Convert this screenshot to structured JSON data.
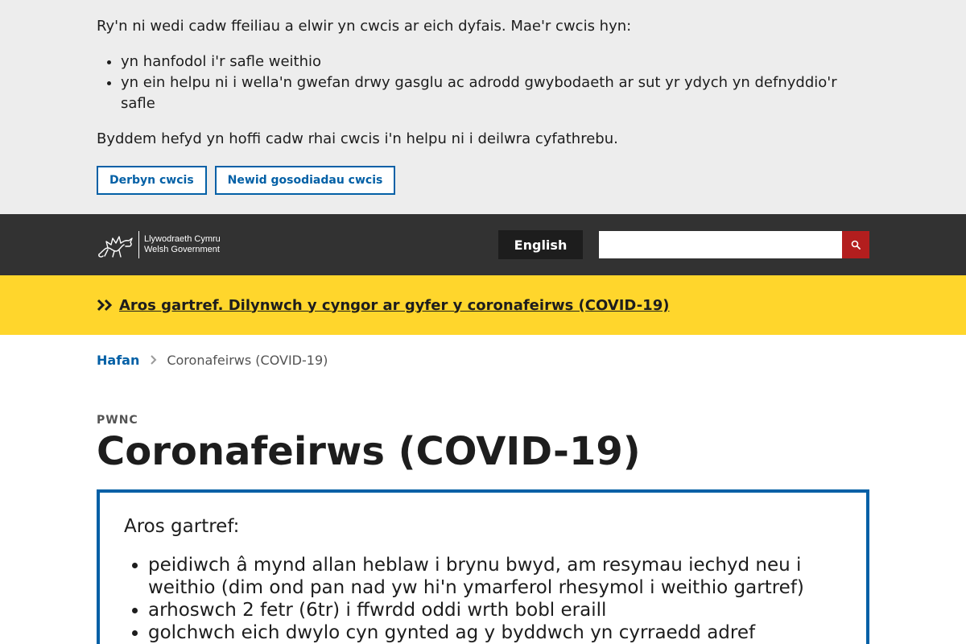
{
  "cookie_banner": {
    "intro": "Ry'n ni wedi cadw ffeiliau a elwir yn cwcis ar eich dyfais. Mae'r cwcis hyn:",
    "items": [
      "yn hanfodol i'r safle weithio",
      "yn ein helpu ni i wella'n gwefan drwy gasglu ac adrodd gwybodaeth ar sut yr ydych yn defnyddio'r safle"
    ],
    "extra": "Byddem hefyd yn hoffi cadw rhai cwcis i'n helpu ni i deilwra cyfathrebu.",
    "accept_label": "Derbyn cwcis",
    "settings_label": "Newid gosodiadau cwcis"
  },
  "header": {
    "logo_line1": "Llywodraeth Cymru",
    "logo_line2": "Welsh Government",
    "language_label": "English",
    "search_placeholder": "",
    "search_icon": "search-icon"
  },
  "alert": {
    "text": "Aros gartref. Dilynwch y cyngor ar gyfer y coronafeirws (COVID-19)",
    "icon": "double-chevron-right-icon"
  },
  "breadcrumb": {
    "home": "Hafan",
    "current": "Coronafeirws (COVID-19)"
  },
  "page": {
    "label": "PWNC",
    "title": "Coronafeirws (COVID-19)"
  },
  "stay_home_box": {
    "heading": "Aros gartref:",
    "items": [
      "peidiwch â mynd allan heblaw i brynu bwyd, am resymau iechyd neu i weithio (dim ond pan nad yw hi'n ymarferol rhesymol i weithio gartref)",
      "arhoswch 2 fetr (6tr) i ffwrdd oddi wrth bobl eraill",
      "golchwch eich dwylo cyn gynted ag y byddwch yn cyrraedd adref"
    ]
  },
  "colors": {
    "cookie_bg": "#ededed",
    "header_bg": "#323232",
    "alert_bg": "#ffd62c",
    "link_blue": "#0360a6",
    "search_red": "#b31e1e"
  }
}
